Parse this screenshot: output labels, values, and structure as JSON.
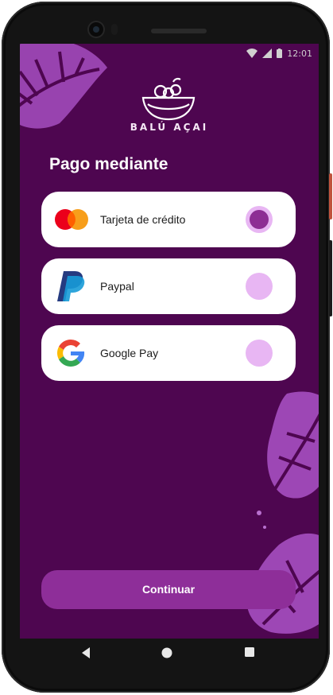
{
  "status": {
    "time": "12:01"
  },
  "brand": {
    "name": "BALÚ AÇAI"
  },
  "payment": {
    "title": "Pago mediante",
    "methods": [
      {
        "label": "Tarjeta de crédito",
        "selected": true,
        "icon": "mastercard-icon"
      },
      {
        "label": "Paypal",
        "selected": false,
        "icon": "paypal-icon"
      },
      {
        "label": "Google Pay",
        "selected": false,
        "icon": "google-icon"
      }
    ]
  },
  "cta": {
    "label": "Continuar"
  },
  "colors": {
    "background": "#4e0650",
    "accent": "#8e2e99",
    "radio": "#e8b6f3",
    "radio_selected": "#8d2d94",
    "leaf": "#a64fc0"
  }
}
